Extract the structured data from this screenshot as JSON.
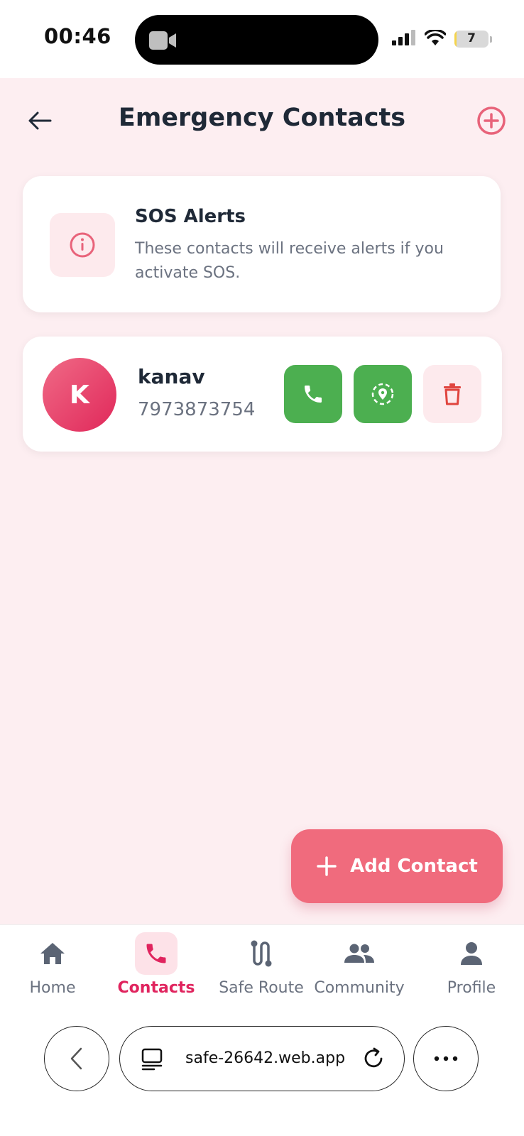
{
  "status_bar": {
    "time": "00:46",
    "battery": "7",
    "battery_level": 0.07
  },
  "header": {
    "title": "Emergency Contacts"
  },
  "info_card": {
    "title": "SOS Alerts",
    "description": "These contacts will receive alerts if you activate SOS."
  },
  "contacts": [
    {
      "initial": "K",
      "name": "kanav",
      "phone": "7973873754"
    }
  ],
  "fab": {
    "label": "Add Contact"
  },
  "bottom_nav": {
    "items": [
      {
        "label": "Home",
        "icon": "home-icon",
        "active": false
      },
      {
        "label": "Contacts",
        "icon": "phone-icon",
        "active": true
      },
      {
        "label": "Safe Route",
        "icon": "route-icon",
        "active": false
      },
      {
        "label": "Community",
        "icon": "people-icon",
        "active": false
      },
      {
        "label": "Profile",
        "icon": "person-icon",
        "active": false
      }
    ]
  },
  "browser": {
    "url": "safe-26642.web.app"
  },
  "colors": {
    "accent": "#e0245e",
    "fab": "#f06b7d",
    "green": "#4caf50",
    "background": "#fdeef1"
  }
}
